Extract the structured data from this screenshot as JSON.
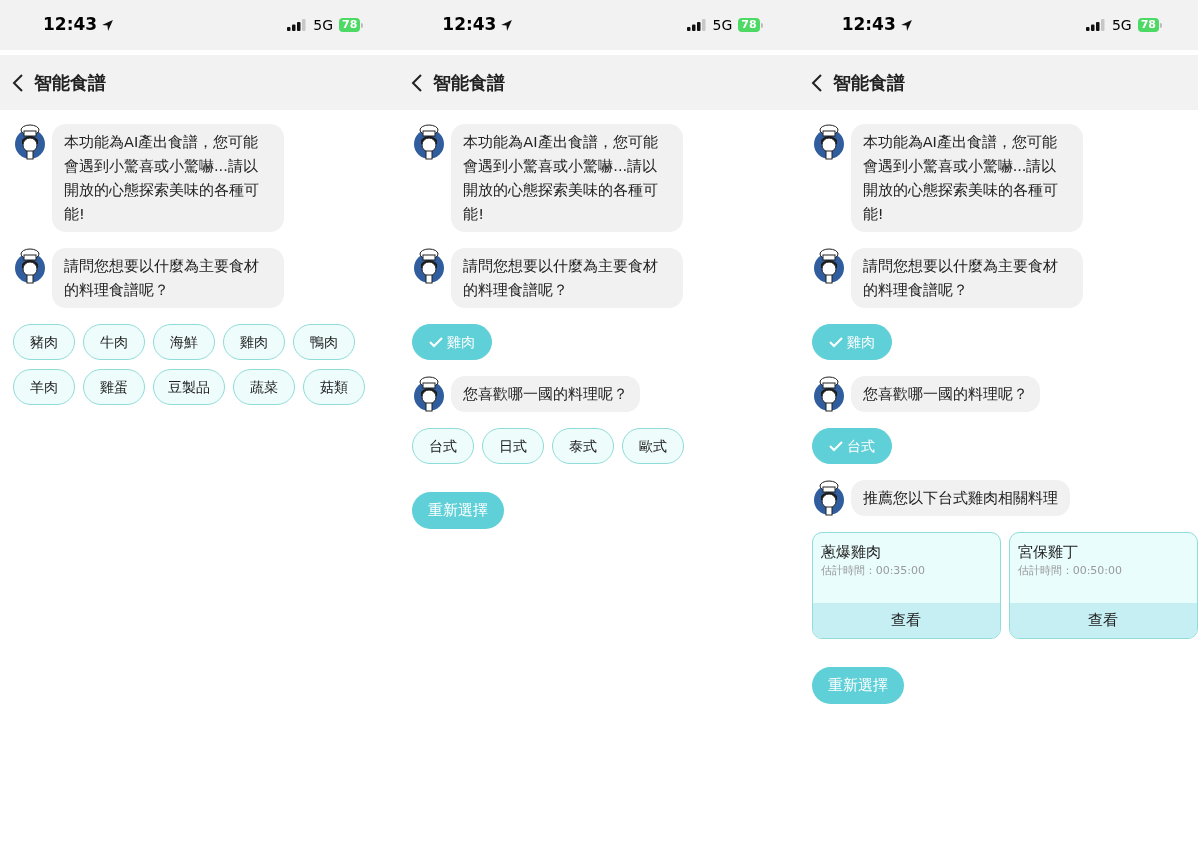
{
  "screens": [
    {
      "status": {
        "time": "12:43",
        "network": "5G",
        "battery": "78"
      },
      "header": {
        "title": "智能食譜"
      },
      "messages": [
        {
          "kind": "bot",
          "text": "本功能為AI產出食譜，您可能會遇到小驚喜或小驚嚇...請以開放的心態探索美味的各種可能!"
        },
        {
          "kind": "bot",
          "text": "請問您想要以什麼為主要食材的料理食譜呢？"
        },
        {
          "kind": "choices",
          "options": [
            {
              "label": "豬肉",
              "selected": false
            },
            {
              "label": "牛肉",
              "selected": false
            },
            {
              "label": "海鮮",
              "selected": false
            },
            {
              "label": "雞肉",
              "selected": false
            },
            {
              "label": "鴨肉",
              "selected": false
            },
            {
              "label": "羊肉",
              "selected": false
            },
            {
              "label": "雞蛋",
              "selected": false
            },
            {
              "label": "豆製品",
              "selected": false
            },
            {
              "label": "蔬菜",
              "selected": false
            },
            {
              "label": "菇類",
              "selected": false
            }
          ]
        }
      ]
    },
    {
      "status": {
        "time": "12:43",
        "network": "5G",
        "battery": "78"
      },
      "header": {
        "title": "智能食譜"
      },
      "messages": [
        {
          "kind": "bot",
          "text": "本功能為AI產出食譜，您可能會遇到小驚喜或小驚嚇...請以開放的心態探索美味的各種可能!"
        },
        {
          "kind": "bot",
          "text": "請問您想要以什麼為主要食材的料理食譜呢？"
        },
        {
          "kind": "choices",
          "options": [
            {
              "label": "雞肉",
              "selected": true
            }
          ]
        },
        {
          "kind": "bot",
          "text": "您喜歡哪一國的料理呢？"
        },
        {
          "kind": "choices",
          "options": [
            {
              "label": "台式",
              "selected": false
            },
            {
              "label": "日式",
              "selected": false
            },
            {
              "label": "泰式",
              "selected": false
            },
            {
              "label": "歐式",
              "selected": false
            }
          ]
        },
        {
          "kind": "button",
          "label": "重新選擇"
        }
      ]
    },
    {
      "status": {
        "time": "12:43",
        "network": "5G",
        "battery": "78"
      },
      "header": {
        "title": "智能食譜"
      },
      "messages": [
        {
          "kind": "bot",
          "text": "本功能為AI產出食譜，您可能會遇到小驚喜或小驚嚇...請以開放的心態探索美味的各種可能!"
        },
        {
          "kind": "bot",
          "text": "請問您想要以什麼為主要食材的料理食譜呢？"
        },
        {
          "kind": "choices",
          "options": [
            {
              "label": "雞肉",
              "selected": true
            }
          ]
        },
        {
          "kind": "bot",
          "text": "您喜歡哪一國的料理呢？"
        },
        {
          "kind": "choices",
          "options": [
            {
              "label": "台式",
              "selected": true
            }
          ]
        },
        {
          "kind": "bot",
          "text": "推薦您以下台式雞肉相關料理"
        },
        {
          "kind": "recipes",
          "cards": [
            {
              "name": "蔥爆雞肉",
              "time": "估計時間：00:35:00",
              "action": "查看"
            },
            {
              "name": "宮保雞丁",
              "time": "估計時間：00:50:00",
              "action": "查看"
            }
          ]
        },
        {
          "kind": "button",
          "label": "重新選擇"
        }
      ]
    }
  ]
}
